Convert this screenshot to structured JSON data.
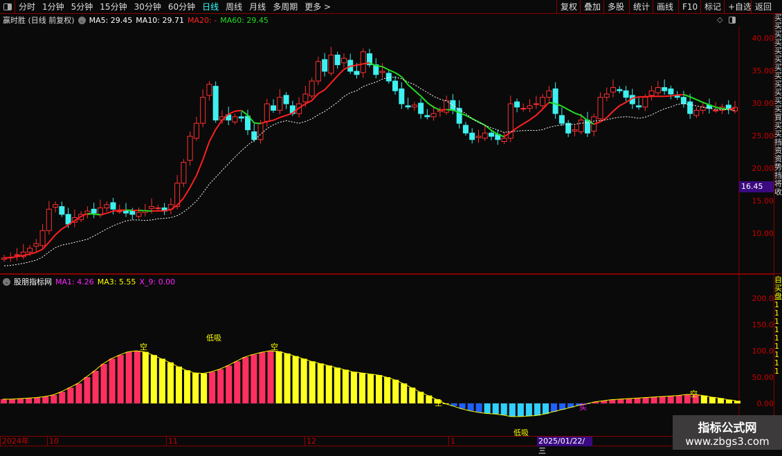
{
  "toolbar": {
    "tabs": [
      "分时",
      "1分钟",
      "5分钟",
      "15分钟",
      "30分钟",
      "60分钟",
      "日线",
      "周线",
      "月线",
      "多周期",
      "更多 >"
    ],
    "active": "日线",
    "right_buttons": [
      "复权",
      "叠加",
      "多股",
      "统计",
      "画线",
      "F10",
      "标记",
      "+自选",
      "返回"
    ]
  },
  "main": {
    "title": "赢时胜 (日线 前复权)",
    "ma5": "MA5: 29.45",
    "ma10": "MA10: 29.71",
    "ma20": "MA20: -",
    "ma60": "MA60: 29.45",
    "price_ticks": [
      "40.00",
      "35.00",
      "30.00",
      "25.00",
      "20.00",
      "15.00",
      "10.00"
    ],
    "current_price_tag": "16.45"
  },
  "indicator": {
    "name": "股朋指标网",
    "ma1": "MA1: 4.26",
    "ma3": "MA3: 5.55",
    "x9": "X_9: 0.00",
    "ticks": [
      "200.0",
      "150.0",
      "100.0",
      "50.00",
      "0.00"
    ],
    "signals": [
      {
        "text": "空"
      },
      {
        "text": "低吸"
      },
      {
        "text": "空"
      },
      {
        "text": "空"
      },
      {
        "text": "低吸"
      },
      {
        "text": "买"
      },
      {
        "text": "空"
      }
    ]
  },
  "date_axis": [
    "2024年",
    "10",
    "11",
    "12",
    "1"
  ],
  "cursor_date": "2025/01/22/三",
  "right_column": "买买买买买买买买买买买买買买买挡资资势挡将收",
  "right_column_lower": "自买盘111111111",
  "watermark": {
    "line1": "指标公式网",
    "line2": "www.zbgs3.com"
  },
  "colors": {
    "up": "#ff3030",
    "down": "#3ff0f0",
    "ma20_up": "#ff2020",
    "ma20_down": "#22dd22",
    "ma60": "#ffffff",
    "ind_up": "#ff3060",
    "ind_down": "#ffff20",
    "ind_neg": "#2060ff"
  },
  "chart_data": [
    {
      "type": "candlestick",
      "ylim": [
        5,
        42
      ],
      "closes": [
        6.3,
        6.4,
        6.8,
        7.2,
        7.8,
        8.5,
        10.5,
        13.8,
        14.5,
        13,
        11.5,
        12.5,
        13,
        13.5,
        13.2,
        14,
        14.5,
        13.8,
        13.5,
        13.2,
        13,
        13.3,
        13.6,
        14.2,
        14,
        13.5,
        14.5,
        17.8,
        21,
        25,
        27,
        31,
        33,
        27.5,
        28,
        27.5,
        28,
        27.8,
        26,
        24.5,
        27,
        30,
        29,
        31,
        30,
        28.5,
        30,
        31.5,
        33.5,
        36.5,
        35,
        37.5,
        36,
        37,
        35,
        34.5,
        38,
        36,
        34.5,
        35,
        33.5,
        32,
        30,
        29.5,
        29.8,
        28.5,
        28,
        28.5,
        29,
        30.5,
        29,
        27,
        25.5,
        24.5,
        25,
        25.5,
        25,
        24.5,
        24.7,
        30,
        29.5,
        29.3,
        29.7,
        30,
        31,
        32,
        28.5,
        27,
        25.5,
        26,
        27.5,
        25.5,
        28,
        31,
        31.5,
        32.5,
        32,
        31,
        30,
        29.5,
        31,
        32,
        32.5,
        32,
        31.5,
        31,
        30,
        28.5,
        29,
        29.5,
        29.3,
        29,
        29.5,
        29.2,
        29.45
      ]
    },
    {
      "type": "bar",
      "ylim": [
        -30,
        230
      ],
      "values": [
        8,
        8,
        9,
        10,
        11,
        13,
        16,
        22,
        30,
        38,
        50,
        62,
        75,
        85,
        92,
        98,
        100,
        98,
        92,
        85,
        78,
        70,
        63,
        58,
        57,
        60,
        65,
        72,
        80,
        88,
        93,
        97,
        100,
        99,
        95,
        90,
        85,
        80,
        76,
        72,
        68,
        64,
        60,
        58,
        56,
        54,
        50,
        45,
        38,
        30,
        22,
        15,
        8,
        0,
        -5,
        -10,
        -14,
        -17,
        -19,
        -20,
        -22,
        -25,
        -25,
        -24,
        -23,
        -20,
        -16,
        -12,
        -8,
        -4,
        -1,
        3,
        5,
        7,
        8,
        9,
        10,
        11,
        12,
        13,
        14,
        15,
        17,
        17,
        15,
        12,
        10,
        7,
        5
      ]
    }
  ]
}
